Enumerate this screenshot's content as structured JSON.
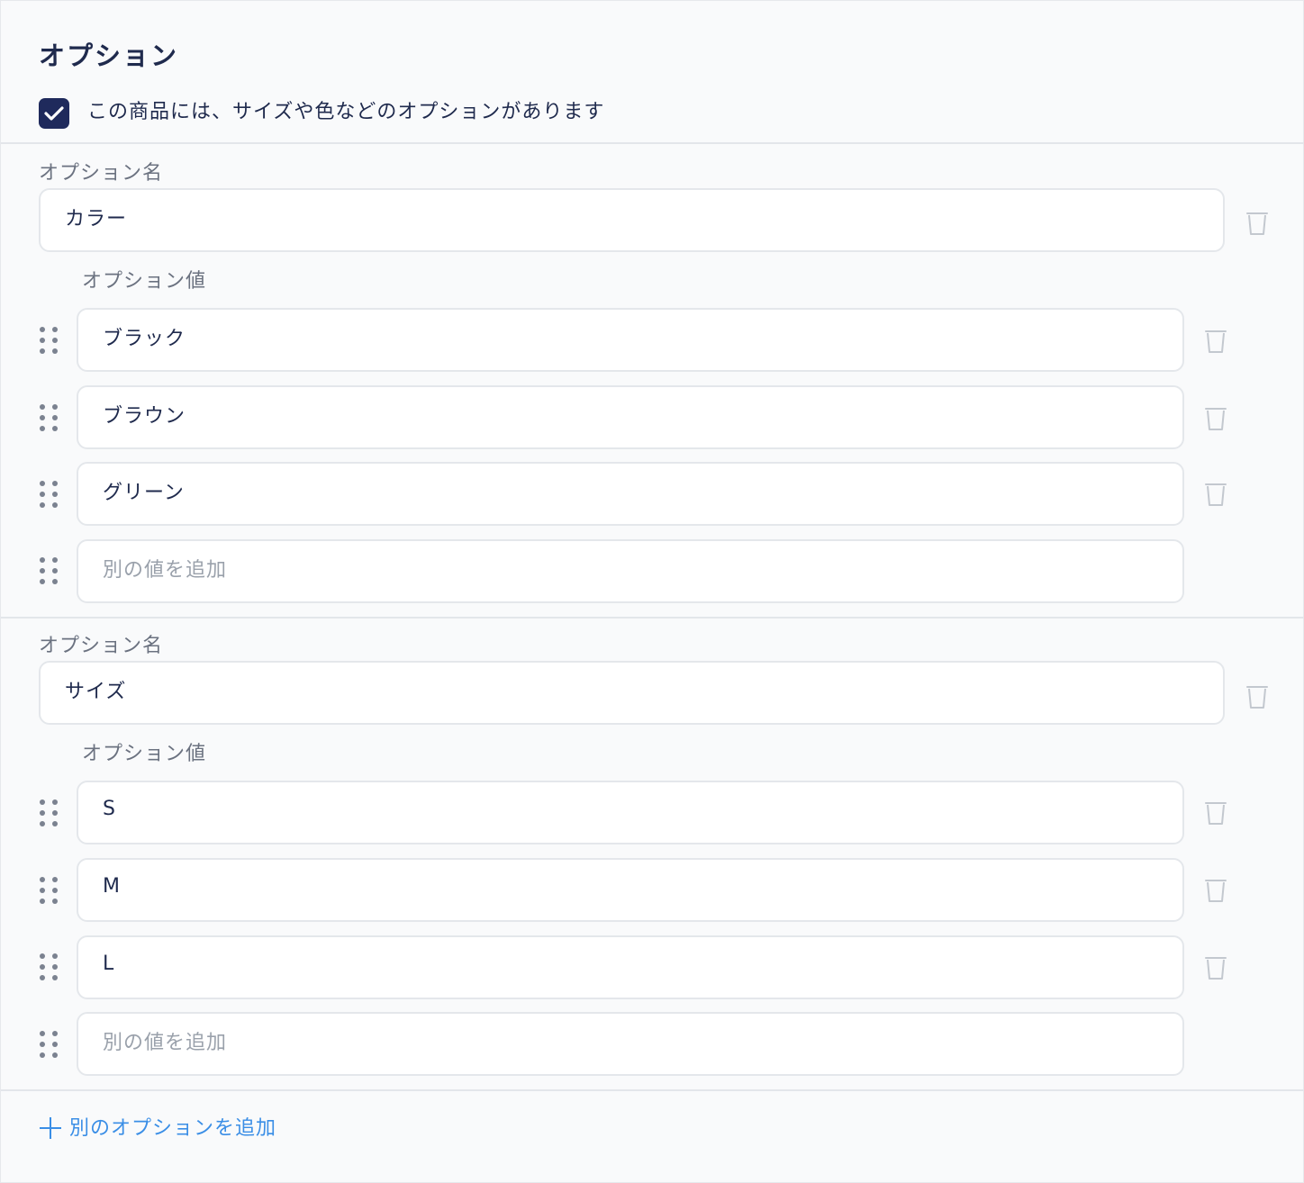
{
  "section": {
    "title": "オプション",
    "has_options_checked": true,
    "has_options_label": "この商品には、サイズや色などのオプションがあります"
  },
  "options": [
    {
      "name_label": "オプション名",
      "name_value": "カラー",
      "values_label": "オプション値",
      "values": [
        "ブラック",
        "ブラウン",
        "グリーン"
      ],
      "add_value_placeholder": "別の値を追加"
    },
    {
      "name_label": "オプション名",
      "name_value": "サイズ",
      "values_label": "オプション値",
      "values": [
        "S",
        "M",
        "L"
      ],
      "add_value_placeholder": "別の値を追加"
    }
  ],
  "add_option_label": "別のオプションを追加",
  "icons": {
    "drag": "drag-handle-icon",
    "delete": "trash-icon",
    "add": "plus-icon",
    "check": "check-icon"
  },
  "colors": {
    "checkbox": "#1f2a5c",
    "link": "#3a8ee6",
    "text": "#1f2a4d",
    "muted": "#6b7280"
  }
}
